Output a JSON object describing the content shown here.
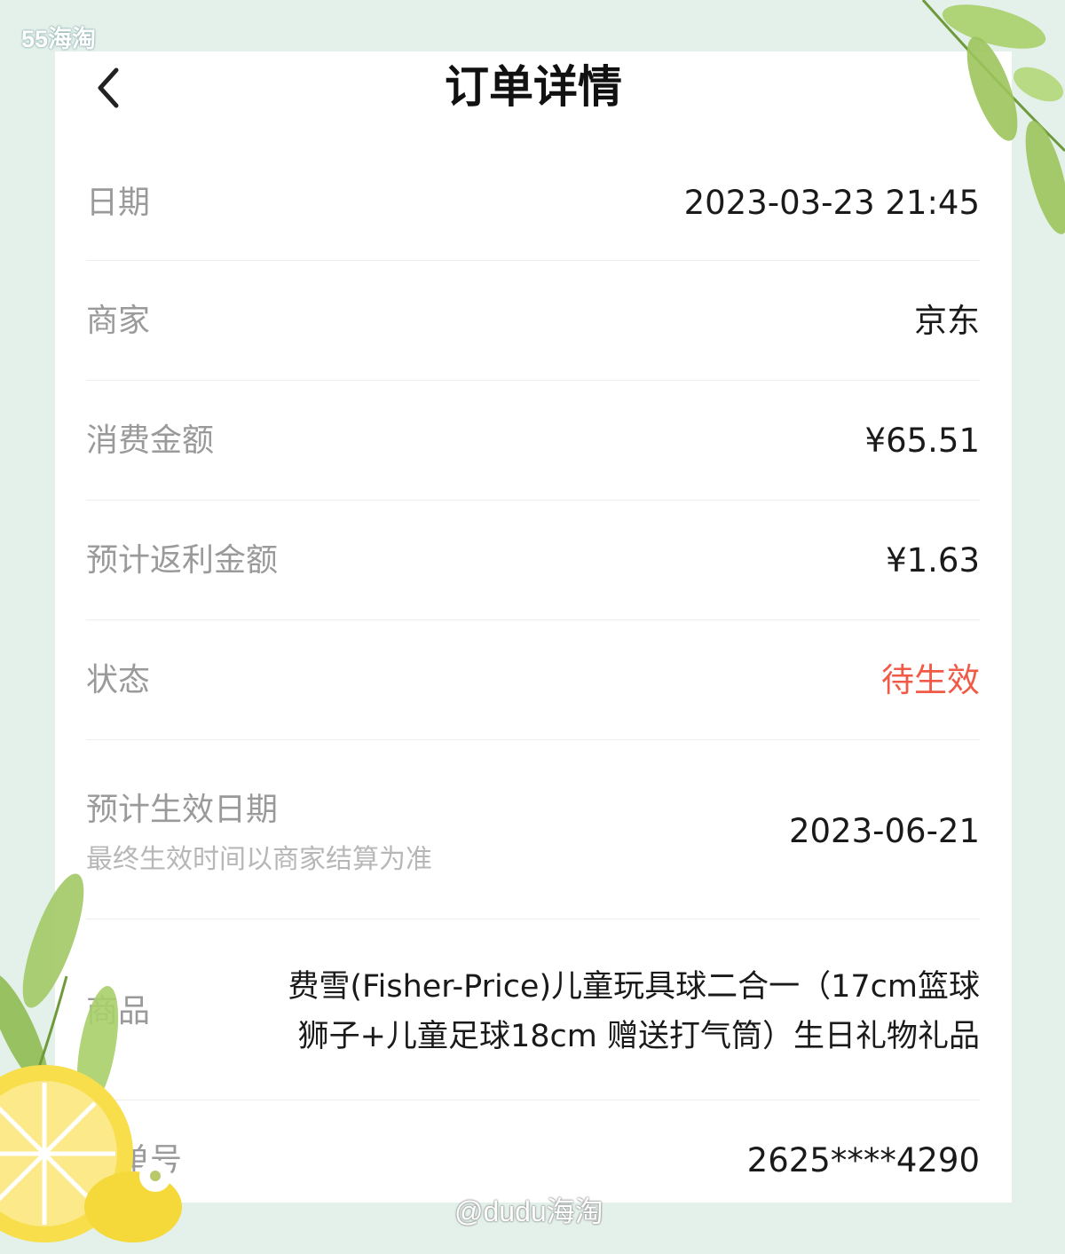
{
  "watermark_top": "55海淘",
  "watermark_bottom": "@dudu海淘",
  "header": {
    "title": "订单详情",
    "back_icon": "chevron-left-icon"
  },
  "order": {
    "date_label": "日期",
    "date_value": "2023-03-23 21:45",
    "merchant_label": "商家",
    "merchant_value": "京东",
    "amount_label": "消费金额",
    "amount_value": "¥65.51",
    "rebate_label": "预计返利金额",
    "rebate_value": "¥1.63",
    "status_label": "状态",
    "status_value": "待生效",
    "status_color": "#f05a46",
    "effective_label": "预计生效日期",
    "effective_note": "最终生效时间以商家结算为准",
    "effective_value": "2023-06-21",
    "product_label": "商品",
    "product_line1": "费雪(Fisher-Price)儿童玩具球二合一（17cm篮球",
    "product_line2": "狮子+儿童足球18cm 赠送打气筒）生日礼物礼品",
    "order_no_label": "订单号",
    "order_no_value": "2625****4290"
  },
  "colors": {
    "background": "#e3f1ea",
    "card": "#ffffff",
    "label": "#9a9a9a",
    "value": "#1a1a1a"
  }
}
